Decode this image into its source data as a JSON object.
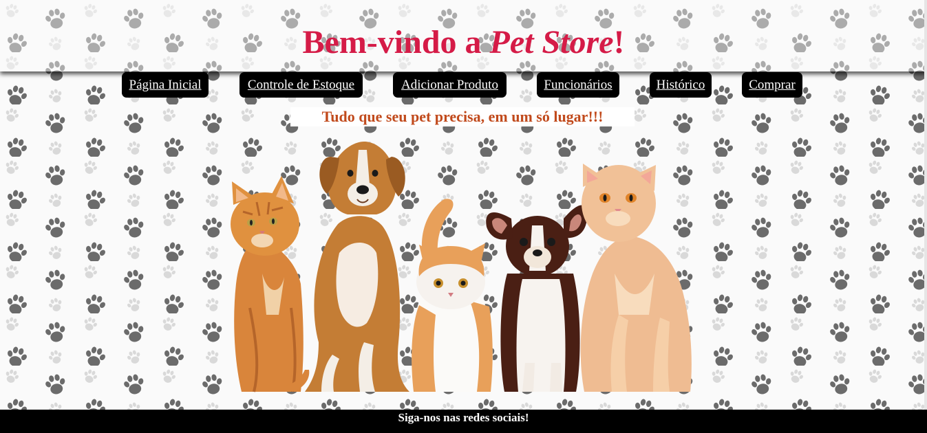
{
  "header": {
    "title_prefix": "Bem-vindo a ",
    "title_emphasis": "Pet Store",
    "title_suffix": "!"
  },
  "nav": {
    "items": [
      {
        "label": "Página Inicial"
      },
      {
        "label": "Controle de Estoque"
      },
      {
        "label": "Adicionar Produto"
      },
      {
        "label": "Funcionários"
      },
      {
        "label": "Histórico"
      },
      {
        "label": "Comprar"
      }
    ]
  },
  "main": {
    "tagline": "Tudo que seu pet precisa, em um só lugar!!!"
  },
  "footer": {
    "text": "Siga-nos nas redes sociais!"
  },
  "colors": {
    "title": "#d51b47",
    "tagline": "#c14a1c",
    "nav_bg": "#000000",
    "footer_bg": "#000000",
    "paw": "#6b6b6b"
  },
  "icons": {
    "background": "paw-print-icon"
  }
}
